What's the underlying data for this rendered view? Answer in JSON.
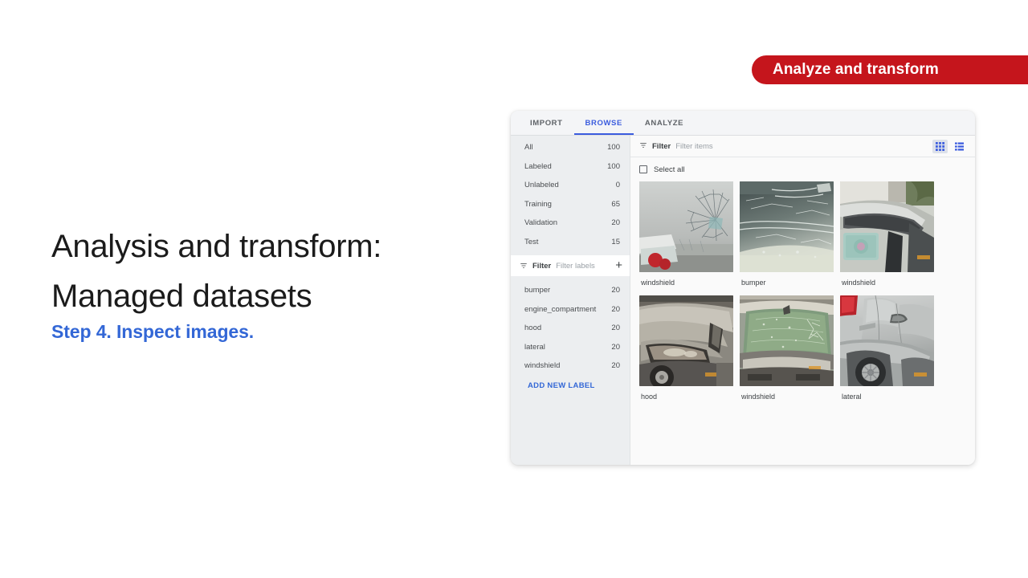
{
  "banner": {
    "label": "Analyze and transform",
    "color": "#c5151c"
  },
  "slide": {
    "title_line1": "Analysis and transform:",
    "title_line2": "Managed datasets",
    "step": "Step 4. Inspect images.",
    "step_color": "#3367d6"
  },
  "app": {
    "tabs": [
      {
        "label": "IMPORT",
        "active": false
      },
      {
        "label": "BROWSE",
        "active": true
      },
      {
        "label": "ANALYZE",
        "active": false
      }
    ],
    "sidebar": {
      "stats": [
        {
          "name": "All",
          "count": "100"
        },
        {
          "name": "Labeled",
          "count": "100"
        },
        {
          "name": "Unlabeled",
          "count": "0"
        },
        {
          "name": "Training",
          "count": "65"
        },
        {
          "name": "Validation",
          "count": "20"
        },
        {
          "name": "Test",
          "count": "15"
        }
      ],
      "label_filter": {
        "icon": "filter-icon",
        "label": "Filter",
        "placeholder": "Filter labels",
        "add_icon": "plus-icon"
      },
      "labels": [
        {
          "name": "bumper",
          "count": "20"
        },
        {
          "name": "engine_compartment",
          "count": "20"
        },
        {
          "name": "hood",
          "count": "20"
        },
        {
          "name": "lateral",
          "count": "20"
        },
        {
          "name": "windshield",
          "count": "20"
        }
      ],
      "add_new_label": "ADD NEW LABEL"
    },
    "content": {
      "filter": {
        "icon": "filter-icon",
        "label": "Filter",
        "placeholder": "Filter items"
      },
      "view_toggles": [
        {
          "icon": "grid-view-icon",
          "active": true
        },
        {
          "icon": "list-view-icon",
          "active": false
        }
      ],
      "select_all": {
        "label": "Select all",
        "checked": false
      },
      "items": [
        {
          "caption": "windshield"
        },
        {
          "caption": "bumper"
        },
        {
          "caption": "windshield"
        },
        {
          "caption": "hood"
        },
        {
          "caption": "windshield"
        },
        {
          "caption": "lateral"
        }
      ]
    }
  }
}
